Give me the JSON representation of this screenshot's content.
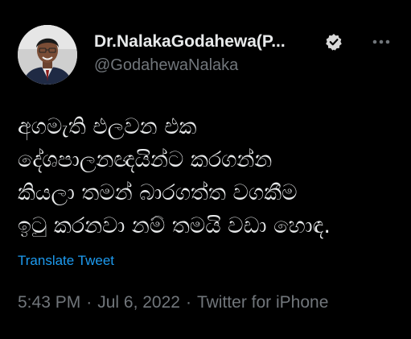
{
  "author": {
    "display_name": "Dr.NalakaGodahewa(P...",
    "handle": "@GodahewaNalaka",
    "verified_icon": "verified-badge-icon",
    "more_icon": "more-horizontal-icon"
  },
  "tweet": {
    "text_lines": [
      "අගමැති එලවන එක",
      "දේශපාලනඥයින්ට කරගන්න",
      "කියලා තමන් බාරගත්ත වගකීම",
      "ඉටු කරනවා නම් තමයි වඩා හොඳ."
    ],
    "translate_label": "Translate Tweet",
    "time": "5:43 PM",
    "separator": "·",
    "date": "Jul 6, 2022",
    "source": "Twitter for iPhone"
  },
  "colors": {
    "background": "#000000",
    "text": "#e7e9ea",
    "secondary": "#71767b",
    "link": "#1d9bf0"
  }
}
